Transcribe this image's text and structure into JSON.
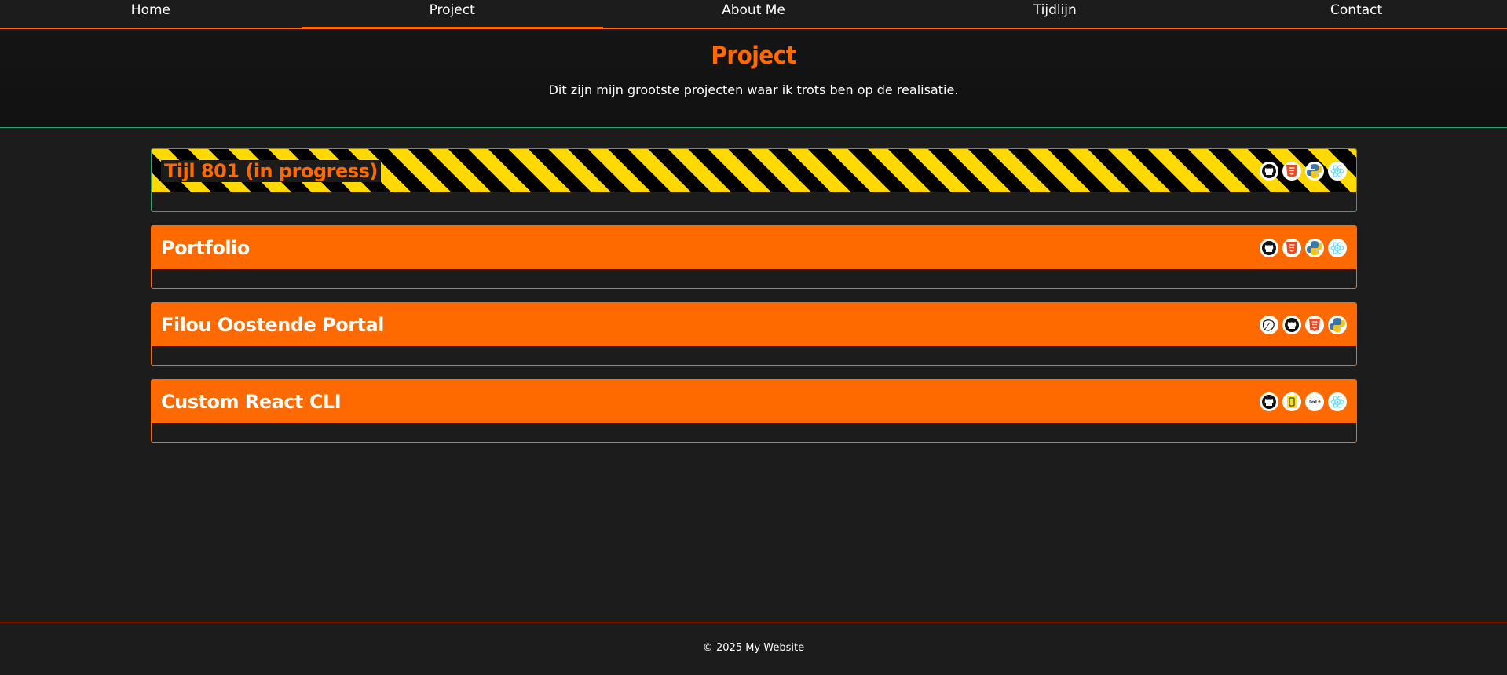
{
  "nav": {
    "items": [
      {
        "label": "Home"
      },
      {
        "label": "Project"
      },
      {
        "label": "About Me"
      },
      {
        "label": "Tijdlijn"
      },
      {
        "label": "Contact"
      }
    ],
    "active": "Project"
  },
  "header": {
    "title": "Project",
    "subtitle": "Dit zijn mijn grootste projecten waar ik trots ben op de realisatie."
  },
  "projects": [
    {
      "title": "Tijl 801 (in progress)",
      "status": "in-progress",
      "icons": [
        "github-icon",
        "html5-icon",
        "python-icon",
        "react-icon"
      ]
    },
    {
      "title": "Portfolio",
      "status": "done",
      "icons": [
        "github-icon",
        "html5-icon",
        "python-icon",
        "react-icon"
      ]
    },
    {
      "title": "Filou Oostende Portal",
      "status": "done",
      "icons": [
        "flask-icon",
        "github-icon",
        "html5-icon",
        "python-icon"
      ]
    },
    {
      "title": "Custom React CLI",
      "status": "done",
      "icons": [
        "github-icon",
        "javascript-icon",
        "nodejs-icon",
        "react-icon"
      ]
    }
  ],
  "footer": {
    "text": "© 2025 My Website"
  },
  "colors": {
    "accent": "#ff6a00",
    "background": "#1c1c1c",
    "divider_green": "#2fa66b",
    "hazard_yellow": "#ffd900"
  }
}
